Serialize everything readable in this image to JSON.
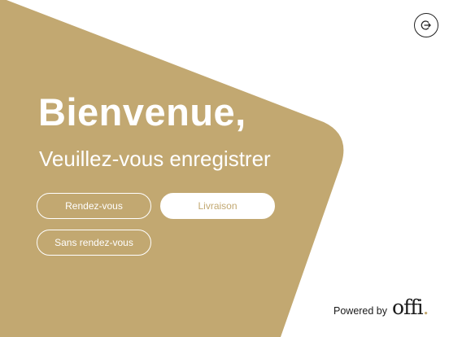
{
  "theme": {
    "accent": "#c2a871",
    "background": "#ffffff",
    "text_light": "#ffffff",
    "text_dark": "#1a1a1a"
  },
  "header": {
    "logout_icon": "logout-icon"
  },
  "welcome": {
    "title": "Bienvenue,",
    "subtitle": "Veuillez-vous enregistrer"
  },
  "actions": {
    "rendezvous_label": "Rendez-vous",
    "livraison_label": "Livraison",
    "sans_rendezvous_label": "Sans rendez-vous"
  },
  "footer": {
    "powered_by": "Powered by",
    "brand": "offi",
    "brand_dot": "."
  }
}
